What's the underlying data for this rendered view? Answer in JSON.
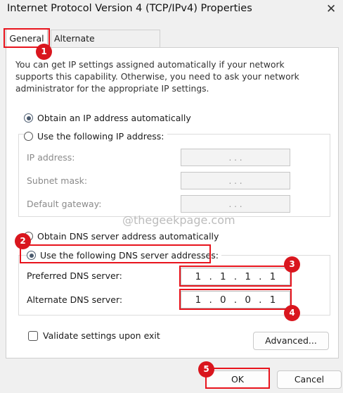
{
  "window": {
    "title": "Internet Protocol Version 4 (TCP/IPv4) Properties",
    "close_glyph": "✕"
  },
  "tabs": [
    {
      "label": "General"
    },
    {
      "label": "Alternate Configuration"
    }
  ],
  "intro_text": "You can get IP settings assigned automatically if your network supports this capability. Otherwise, you need to ask your network administrator for the appropriate IP settings.",
  "ip": {
    "auto_label": "Obtain an IP address automatically",
    "manual_label": "Use the following IP address:",
    "auto_selected": true,
    "fields": [
      {
        "label": "IP address:",
        "value": ". . ."
      },
      {
        "label": "Subnet mask:",
        "value": ". . ."
      },
      {
        "label": "Default gateway:",
        "value": ". . ."
      }
    ]
  },
  "watermark": "@thegeekpage.com",
  "dns": {
    "auto_label": "Obtain DNS server address automatically",
    "manual_label": "Use the following DNS server addresses:",
    "manual_selected": true,
    "preferred": {
      "label": "Preferred DNS server:",
      "octets": [
        "1",
        "1",
        "1",
        "1"
      ]
    },
    "alternate": {
      "label": "Alternate DNS server:",
      "octets": [
        "1",
        "0",
        "0",
        "1"
      ]
    }
  },
  "validate_label": "Validate settings upon exit",
  "validate_checked": false,
  "buttons": {
    "advanced": "Advanced...",
    "ok": "OK",
    "cancel": "Cancel"
  },
  "annotations": [
    "1",
    "2",
    "3",
    "4",
    "5"
  ],
  "colors": {
    "highlight": "#e8141d",
    "badge": "#d9161e"
  }
}
